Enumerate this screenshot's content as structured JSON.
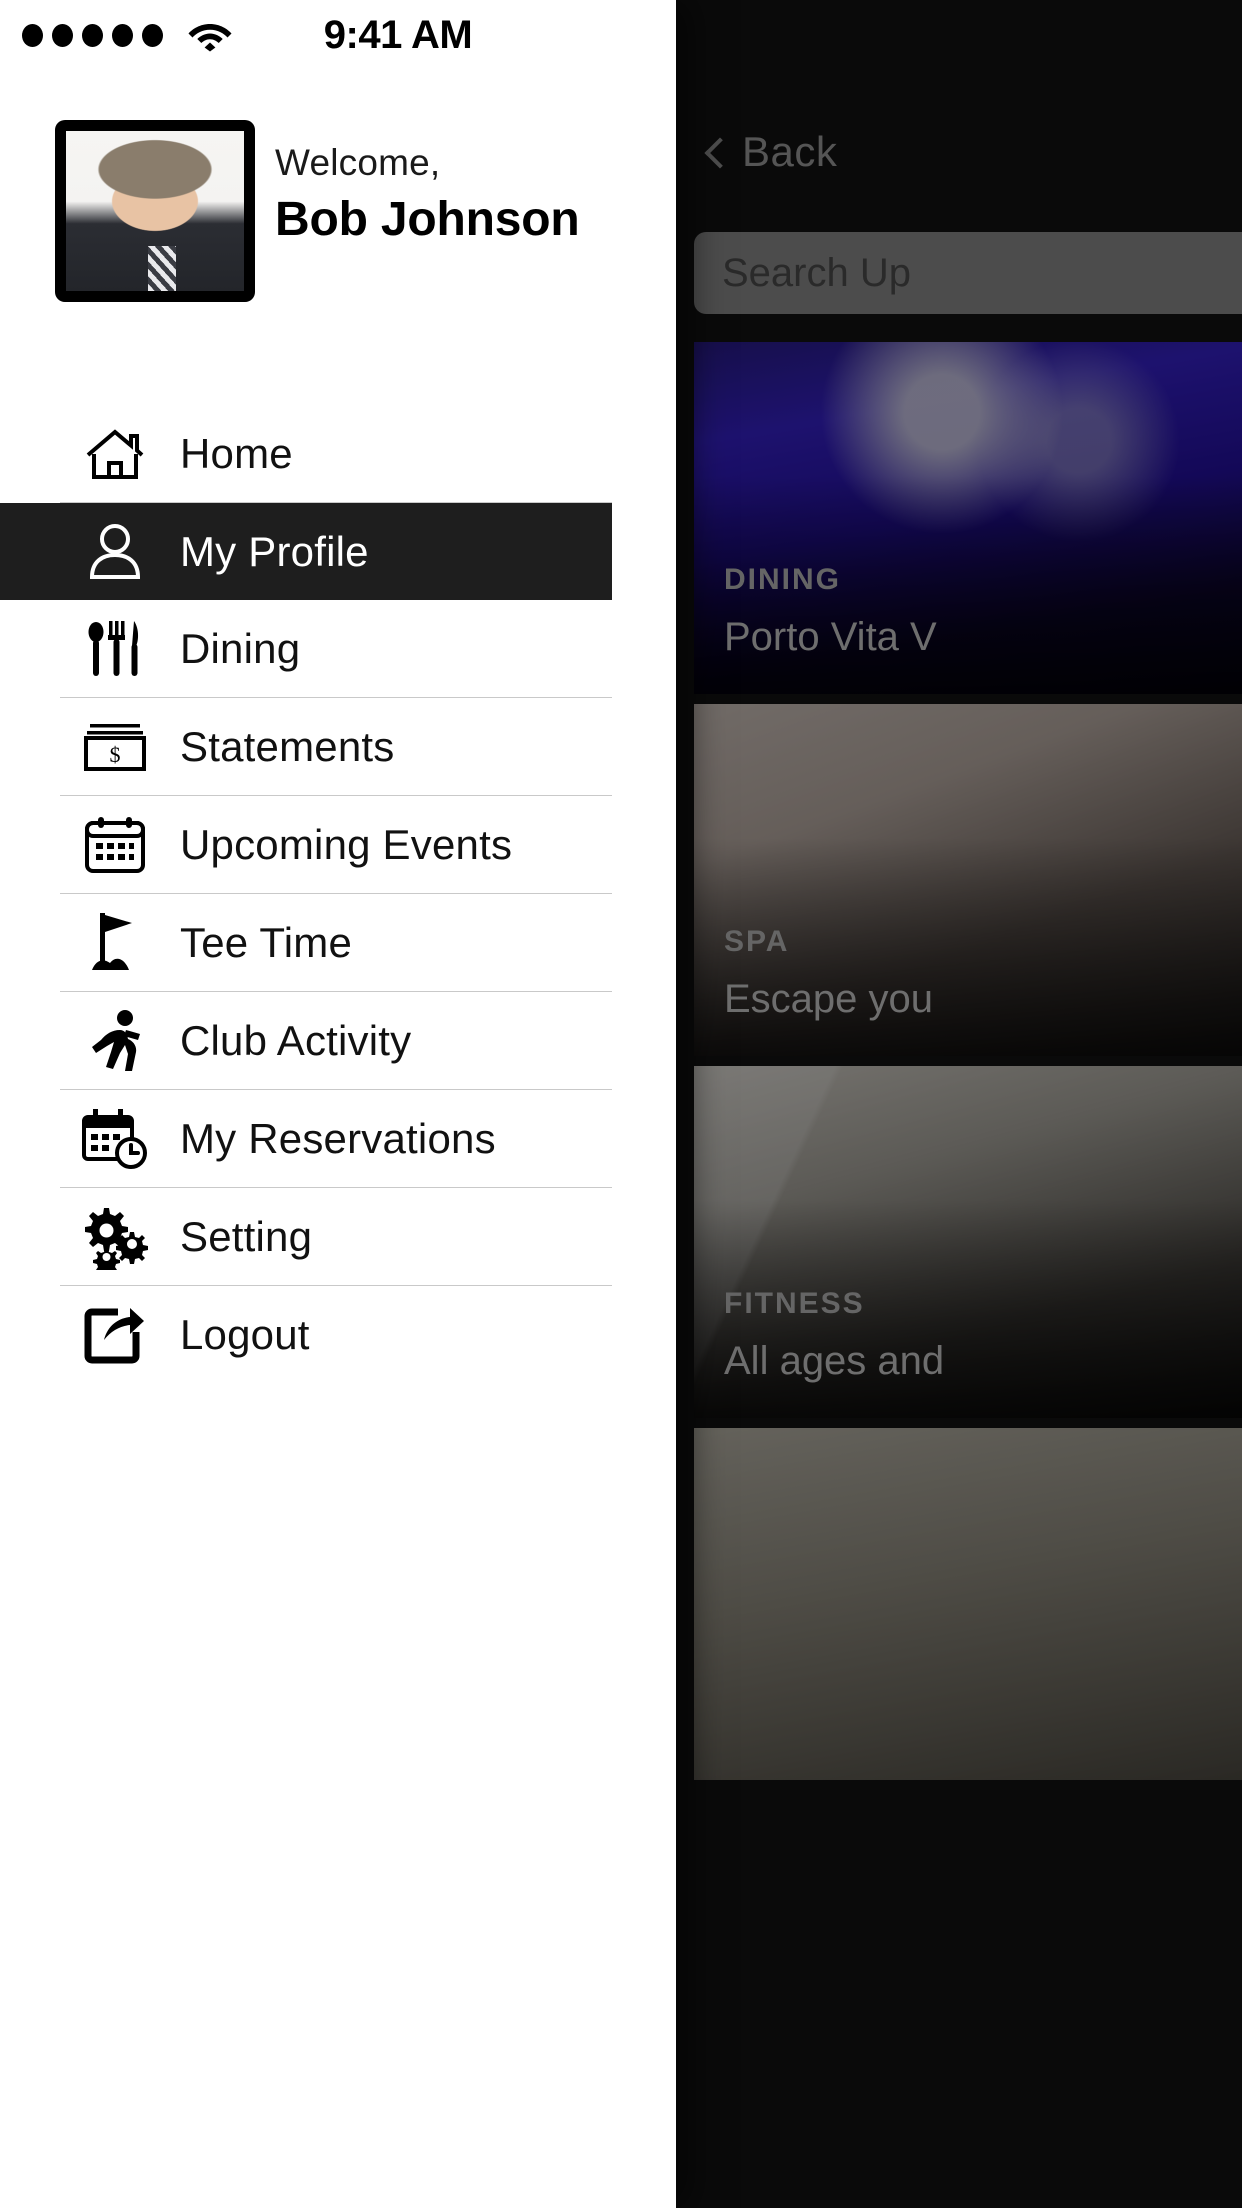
{
  "status_bar": {
    "signal_dots": 5,
    "wifi_icon": "wifi-icon",
    "time": "9:41 AM"
  },
  "drawer": {
    "profile": {
      "avatar_icon": "user-avatar-photo",
      "welcome_label": "Welcome,",
      "user_name": "Bob Johnson"
    },
    "menu_items": [
      {
        "label": "Home",
        "icon": "home-icon",
        "active": false,
        "divider_after": true
      },
      {
        "label": "My Profile",
        "icon": "person-icon",
        "active": true,
        "divider_after": false
      },
      {
        "label": "Dining",
        "icon": "cutlery-icon",
        "active": false,
        "divider_after": true
      },
      {
        "label": "Statements",
        "icon": "money-stack-icon",
        "active": false,
        "divider_after": true
      },
      {
        "label": "Upcoming Events",
        "icon": "calendar-icon",
        "active": false,
        "divider_after": true
      },
      {
        "label": "Tee Time",
        "icon": "golf-flag-icon",
        "active": false,
        "divider_after": true
      },
      {
        "label": "Club Activity",
        "icon": "runner-icon",
        "active": false,
        "divider_after": true
      },
      {
        "label": "My Reservations",
        "icon": "calendar-clock-icon",
        "active": false,
        "divider_after": true
      },
      {
        "label": "Setting",
        "icon": "gears-icon",
        "active": false,
        "divider_after": true
      },
      {
        "label": "Logout",
        "icon": "logout-icon",
        "active": false,
        "divider_after": false
      }
    ]
  },
  "content": {
    "back_button": {
      "label": "Back",
      "icon": "chevron-left-icon"
    },
    "search": {
      "placeholder": "Search Up",
      "value": ""
    },
    "cards": [
      {
        "category": "DINING",
        "title": "Porto Vita V"
      },
      {
        "category": "SPA",
        "title": "Escape you"
      },
      {
        "category": "FITNESS",
        "title": "All ages and"
      },
      {
        "category": "",
        "title": ""
      }
    ]
  },
  "colors": {
    "drawer_bg": "#ffffff",
    "active_item_bg": "#1e1e1e",
    "content_bg": "#131313",
    "divider": "#c9c9c9",
    "muted_text": "#9b9b9b"
  }
}
